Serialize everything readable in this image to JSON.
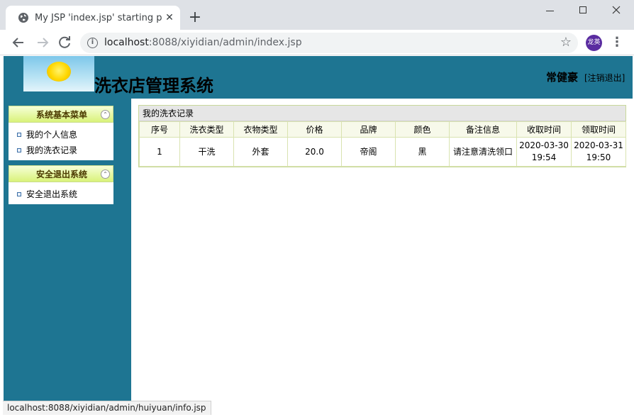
{
  "browser": {
    "tab_title": "My JSP 'index.jsp' starting page",
    "tab_close": "✕",
    "new_tab": "+",
    "url_host": "localhost",
    "url_path": ":8088/xiyidian/admin/index.jsp",
    "profile_label": "龙英",
    "status_url": "localhost:8088/xiyidian/admin/huiyuan/info.jsp",
    "icons": {
      "back": "arrow-left-icon",
      "forward": "arrow-right-icon",
      "reload": "reload-icon",
      "info": "info-icon",
      "bookmark": "star-icon",
      "menu": "kebab-menu-icon"
    }
  },
  "header": {
    "system_title": "洗衣店管理系统",
    "user_name": "常健豪",
    "logout_text": "[注销退出]",
    "bg_color": "#1e7592"
  },
  "sidebar": {
    "groups": [
      {
        "title": "系统基本菜单",
        "items": [
          {
            "label": "我的个人信息"
          },
          {
            "label": "我的洗衣记录"
          }
        ]
      },
      {
        "title": "安全退出系统",
        "items": [
          {
            "label": "安全退出系统"
          }
        ]
      }
    ]
  },
  "main": {
    "panel_title": "我的洗衣记录",
    "columns": [
      "序号",
      "洗衣类型",
      "衣物类型",
      "价格",
      "品牌",
      "颜色",
      "备注信息",
      "收取时间",
      "领取时间"
    ],
    "rows": [
      {
        "no": "1",
        "wash_type": "干洗",
        "clothes_type": "外套",
        "price": "20.0",
        "brand": "帝阁",
        "color": "黑",
        "remark": "请注意清洗领口",
        "receive_date": "2020-03-30",
        "receive_time": "19:54",
        "pickup_date": "2020-03-31",
        "pickup_time": "19:50"
      }
    ]
  }
}
